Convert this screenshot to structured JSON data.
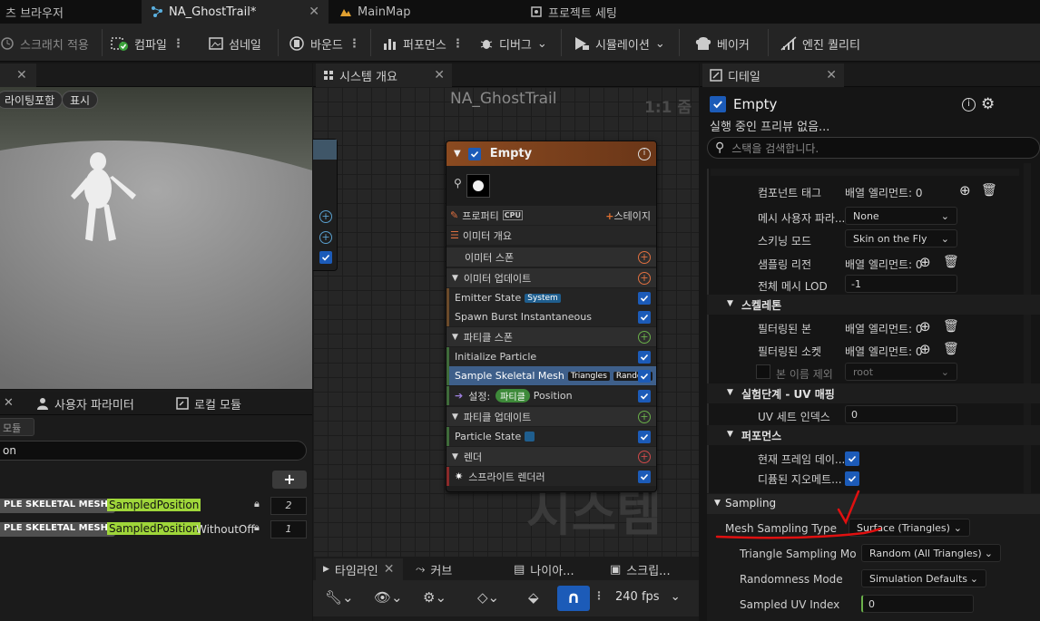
{
  "tabs": [
    {
      "label": "츠 브라우저"
    },
    {
      "label": "NA_GhostTrail*"
    },
    {
      "label": "MainMap"
    },
    {
      "label": "프로젝트 세팅"
    }
  ],
  "toolbar": {
    "scratch": "스크래치 적용",
    "compile": "컴파일",
    "thumbnail": "섬네일",
    "bounds": "바운드",
    "performance": "퍼포먼스",
    "debug": "디버그",
    "simulation": "시뮬레이션",
    "baker": "베이커",
    "scalability": "엔진 퀄리티"
  },
  "viewport": {
    "chip_lighting": "라이팅포함",
    "chip_show": "표시"
  },
  "graph": {
    "tab": "시스템 개요",
    "title": "NA_GhostTrail",
    "zoom": "1:1 줌",
    "watermark": "시스템"
  },
  "node": {
    "title": "Empty",
    "properties": "프로퍼티",
    "cpu": "CPU",
    "stage": "스테이지",
    "emitter_summary": "이미터 개요",
    "emitter_spawn": "이미터 스폰",
    "emitter_update": "이미터 업데이트",
    "emitter_state": "Emitter State",
    "emitter_state_badge": "System",
    "spawn_burst": "Spawn Burst Instantaneous",
    "particle_spawn": "파티클 스폰",
    "init_particle": "Initialize Particle",
    "sample_skel": "Sample Skeletal Mesh",
    "sample_badge1": "Triangles",
    "sample_badge2": "Random",
    "set_label": "설정:",
    "set_badge": "파티클",
    "set_target": "Position",
    "particle_update": "파티클 업데이트",
    "particle_state": "Particle State",
    "render": "렌더",
    "sprite_renderer": "스프라이트 렌더러"
  },
  "bottom_left": {
    "tab_user_params": "사용자 파라미터",
    "tab_local_modules": "로컬 모듈",
    "module_label": "모듈",
    "search_value": "on",
    "rows": [
      {
        "prefix": "PLE SKELETAL MESH",
        "name": "SampledPosition",
        "suffix": "",
        "count": "2"
      },
      {
        "prefix": "PLE SKELETAL MESH",
        "name": "SampledPosition",
        "suffix": "WithoutOff",
        "count": "1"
      }
    ]
  },
  "bottom_mid": {
    "timeline": "타임라인",
    "curves": "커브",
    "niagara": "나이아...",
    "script": "스크립...",
    "fps": "240 fps"
  },
  "details": {
    "tab": "디테일",
    "emitter_name": "Empty",
    "preview_status": "실행 중인 프리뷰 없음...",
    "search_placeholder": "스택을 검색합니다.",
    "top_rows": [
      {
        "label": "컴포넌트 태그",
        "value": "배열 엘리먼트: 0"
      },
      {
        "label": "메시 사용자 파라...",
        "value": "None"
      },
      {
        "label": "스키닝 모드",
        "value": "Skin on the Fly"
      },
      {
        "label": "샘플링 리전",
        "value": "배열 엘리먼트: 0"
      },
      {
        "label": "전체 메시 LOD",
        "value": "-1"
      }
    ],
    "skeleton_cat": "스켈레톤",
    "skeleton_rows": [
      {
        "label": "필터링된 본",
        "value": "배열 엘리먼트: 0"
      },
      {
        "label": "필터링된 소켓",
        "value": "배열 엘리먼트: 0"
      },
      {
        "label": "본 이름 제외",
        "value": "root"
      }
    ],
    "uv_cat": "실험단계 - UV 매핑",
    "uv_row": {
      "label": "UV 세트 인덱스",
      "value": "0"
    },
    "perf_cat": "퍼포먼스",
    "perf_rows": [
      {
        "label": "현재 프레임 데이..."
      },
      {
        "label": "디퓸된 지오메트..."
      }
    ],
    "sampling_cat": "Sampling",
    "sampling_rows": [
      {
        "label": "Mesh Sampling Type",
        "value": "Surface (Triangles)"
      },
      {
        "label": "Triangle Sampling Mo",
        "value": "Random (All Triangles)"
      },
      {
        "label": "Randomness Mode",
        "value": "Simulation Defaults"
      },
      {
        "label": "Sampled UV Index",
        "value": "0"
      }
    ]
  },
  "colors": {
    "accent_blue": "#1c5bb8",
    "annotation_red": "#e01010",
    "param_green": "#9fd63a"
  }
}
